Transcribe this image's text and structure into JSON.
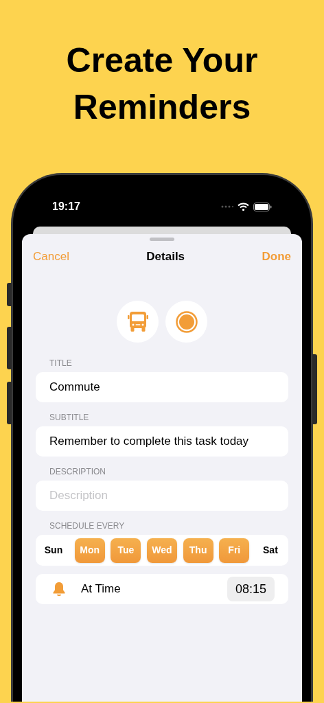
{
  "headline": "Create Your Reminders",
  "status_bar": {
    "time": "19:17"
  },
  "nav": {
    "cancel": "Cancel",
    "title": "Details",
    "done": "Done"
  },
  "fields": [
    {
      "label": "TITLE",
      "value": "Commute"
    },
    {
      "label": "SUBTITLE",
      "value": "Remember to complete this task today"
    },
    {
      "label": "DESCRIPTION",
      "placeholder": "Description"
    }
  ],
  "schedule": {
    "label": "SCHEDULE EVERY",
    "days": [
      {
        "label": "Sun",
        "selected": false
      },
      {
        "label": "Mon",
        "selected": true
      },
      {
        "label": "Tue",
        "selected": true
      },
      {
        "label": "Wed",
        "selected": true
      },
      {
        "label": "Thu",
        "selected": true
      },
      {
        "label": "Fri",
        "selected": true
      },
      {
        "label": "Sat",
        "selected": false
      }
    ]
  },
  "alarm": {
    "label": "At Time",
    "time": "08:15"
  }
}
